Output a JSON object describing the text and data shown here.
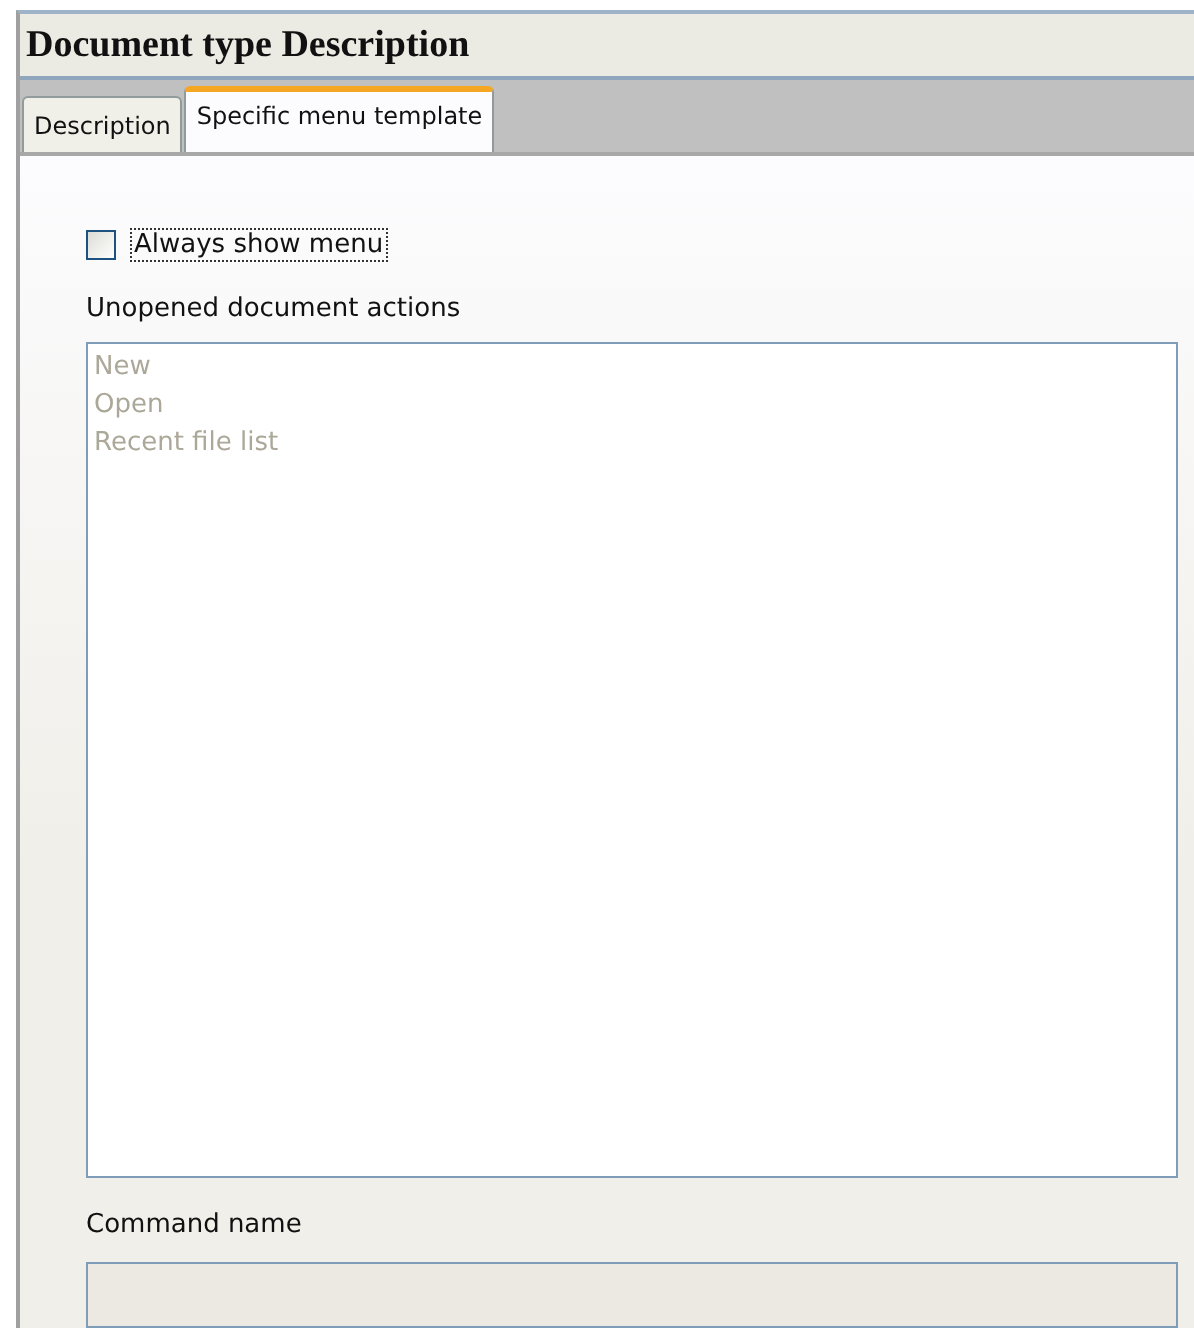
{
  "window": {
    "title": "Document type Description"
  },
  "tabs": [
    {
      "label": "Description",
      "selected": false
    },
    {
      "label": "Specific menu template",
      "selected": true
    }
  ],
  "always_show_menu": {
    "label": "Always show menu",
    "checked": false
  },
  "actions": {
    "label": "Unopened document actions",
    "items": [
      {
        "label": "New",
        "disabled": true
      },
      {
        "label": "Open",
        "disabled": true
      },
      {
        "label": "Recent file list",
        "disabled": true
      }
    ]
  },
  "command_name": {
    "label": "Command name",
    "disabled": true
  }
}
